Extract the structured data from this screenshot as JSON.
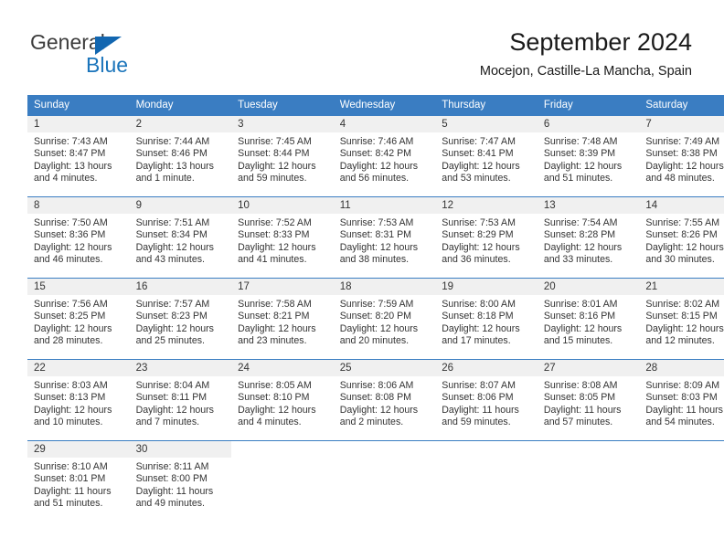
{
  "brand": {
    "name_top": "General",
    "name_bottom": "Blue",
    "accent_color": "#1b75bb",
    "triangle_color": "#1266b0"
  },
  "header": {
    "title": "September 2024",
    "subtitle": "Mocejon, Castille-La Mancha, Spain",
    "header_bg_color": "#3a7dc2",
    "header_text_color": "#ffffff"
  },
  "weekday_headers": [
    "Sunday",
    "Monday",
    "Tuesday",
    "Wednesday",
    "Thursday",
    "Friday",
    "Saturday"
  ],
  "labels": {
    "sunrise_prefix": "Sunrise:",
    "sunset_prefix": "Sunset:",
    "daylight_prefix": "Daylight:"
  },
  "weeks": [
    [
      {
        "day": "1",
        "sunrise": "Sunrise: 7:43 AM",
        "sunset": "Sunset: 8:47 PM",
        "daylight1": "Daylight: 13 hours",
        "daylight2": "and 4 minutes."
      },
      {
        "day": "2",
        "sunrise": "Sunrise: 7:44 AM",
        "sunset": "Sunset: 8:46 PM",
        "daylight1": "Daylight: 13 hours",
        "daylight2": "and 1 minute."
      },
      {
        "day": "3",
        "sunrise": "Sunrise: 7:45 AM",
        "sunset": "Sunset: 8:44 PM",
        "daylight1": "Daylight: 12 hours",
        "daylight2": "and 59 minutes."
      },
      {
        "day": "4",
        "sunrise": "Sunrise: 7:46 AM",
        "sunset": "Sunset: 8:42 PM",
        "daylight1": "Daylight: 12 hours",
        "daylight2": "and 56 minutes."
      },
      {
        "day": "5",
        "sunrise": "Sunrise: 7:47 AM",
        "sunset": "Sunset: 8:41 PM",
        "daylight1": "Daylight: 12 hours",
        "daylight2": "and 53 minutes."
      },
      {
        "day": "6",
        "sunrise": "Sunrise: 7:48 AM",
        "sunset": "Sunset: 8:39 PM",
        "daylight1": "Daylight: 12 hours",
        "daylight2": "and 51 minutes."
      },
      {
        "day": "7",
        "sunrise": "Sunrise: 7:49 AM",
        "sunset": "Sunset: 8:38 PM",
        "daylight1": "Daylight: 12 hours",
        "daylight2": "and 48 minutes."
      }
    ],
    [
      {
        "day": "8",
        "sunrise": "Sunrise: 7:50 AM",
        "sunset": "Sunset: 8:36 PM",
        "daylight1": "Daylight: 12 hours",
        "daylight2": "and 46 minutes."
      },
      {
        "day": "9",
        "sunrise": "Sunrise: 7:51 AM",
        "sunset": "Sunset: 8:34 PM",
        "daylight1": "Daylight: 12 hours",
        "daylight2": "and 43 minutes."
      },
      {
        "day": "10",
        "sunrise": "Sunrise: 7:52 AM",
        "sunset": "Sunset: 8:33 PM",
        "daylight1": "Daylight: 12 hours",
        "daylight2": "and 41 minutes."
      },
      {
        "day": "11",
        "sunrise": "Sunrise: 7:53 AM",
        "sunset": "Sunset: 8:31 PM",
        "daylight1": "Daylight: 12 hours",
        "daylight2": "and 38 minutes."
      },
      {
        "day": "12",
        "sunrise": "Sunrise: 7:53 AM",
        "sunset": "Sunset: 8:29 PM",
        "daylight1": "Daylight: 12 hours",
        "daylight2": "and 36 minutes."
      },
      {
        "day": "13",
        "sunrise": "Sunrise: 7:54 AM",
        "sunset": "Sunset: 8:28 PM",
        "daylight1": "Daylight: 12 hours",
        "daylight2": "and 33 minutes."
      },
      {
        "day": "14",
        "sunrise": "Sunrise: 7:55 AM",
        "sunset": "Sunset: 8:26 PM",
        "daylight1": "Daylight: 12 hours",
        "daylight2": "and 30 minutes."
      }
    ],
    [
      {
        "day": "15",
        "sunrise": "Sunrise: 7:56 AM",
        "sunset": "Sunset: 8:25 PM",
        "daylight1": "Daylight: 12 hours",
        "daylight2": "and 28 minutes."
      },
      {
        "day": "16",
        "sunrise": "Sunrise: 7:57 AM",
        "sunset": "Sunset: 8:23 PM",
        "daylight1": "Daylight: 12 hours",
        "daylight2": "and 25 minutes."
      },
      {
        "day": "17",
        "sunrise": "Sunrise: 7:58 AM",
        "sunset": "Sunset: 8:21 PM",
        "daylight1": "Daylight: 12 hours",
        "daylight2": "and 23 minutes."
      },
      {
        "day": "18",
        "sunrise": "Sunrise: 7:59 AM",
        "sunset": "Sunset: 8:20 PM",
        "daylight1": "Daylight: 12 hours",
        "daylight2": "and 20 minutes."
      },
      {
        "day": "19",
        "sunrise": "Sunrise: 8:00 AM",
        "sunset": "Sunset: 8:18 PM",
        "daylight1": "Daylight: 12 hours",
        "daylight2": "and 17 minutes."
      },
      {
        "day": "20",
        "sunrise": "Sunrise: 8:01 AM",
        "sunset": "Sunset: 8:16 PM",
        "daylight1": "Daylight: 12 hours",
        "daylight2": "and 15 minutes."
      },
      {
        "day": "21",
        "sunrise": "Sunrise: 8:02 AM",
        "sunset": "Sunset: 8:15 PM",
        "daylight1": "Daylight: 12 hours",
        "daylight2": "and 12 minutes."
      }
    ],
    [
      {
        "day": "22",
        "sunrise": "Sunrise: 8:03 AM",
        "sunset": "Sunset: 8:13 PM",
        "daylight1": "Daylight: 12 hours",
        "daylight2": "and 10 minutes."
      },
      {
        "day": "23",
        "sunrise": "Sunrise: 8:04 AM",
        "sunset": "Sunset: 8:11 PM",
        "daylight1": "Daylight: 12 hours",
        "daylight2": "and 7 minutes."
      },
      {
        "day": "24",
        "sunrise": "Sunrise: 8:05 AM",
        "sunset": "Sunset: 8:10 PM",
        "daylight1": "Daylight: 12 hours",
        "daylight2": "and 4 minutes."
      },
      {
        "day": "25",
        "sunrise": "Sunrise: 8:06 AM",
        "sunset": "Sunset: 8:08 PM",
        "daylight1": "Daylight: 12 hours",
        "daylight2": "and 2 minutes."
      },
      {
        "day": "26",
        "sunrise": "Sunrise: 8:07 AM",
        "sunset": "Sunset: 8:06 PM",
        "daylight1": "Daylight: 11 hours",
        "daylight2": "and 59 minutes."
      },
      {
        "day": "27",
        "sunrise": "Sunrise: 8:08 AM",
        "sunset": "Sunset: 8:05 PM",
        "daylight1": "Daylight: 11 hours",
        "daylight2": "and 57 minutes."
      },
      {
        "day": "28",
        "sunrise": "Sunrise: 8:09 AM",
        "sunset": "Sunset: 8:03 PM",
        "daylight1": "Daylight: 11 hours",
        "daylight2": "and 54 minutes."
      }
    ],
    [
      {
        "day": "29",
        "sunrise": "Sunrise: 8:10 AM",
        "sunset": "Sunset: 8:01 PM",
        "daylight1": "Daylight: 11 hours",
        "daylight2": "and 51 minutes."
      },
      {
        "day": "30",
        "sunrise": "Sunrise: 8:11 AM",
        "sunset": "Sunset: 8:00 PM",
        "daylight1": "Daylight: 11 hours",
        "daylight2": "and 49 minutes."
      },
      {
        "day": "",
        "sunrise": "",
        "sunset": "",
        "daylight1": "",
        "daylight2": ""
      },
      {
        "day": "",
        "sunrise": "",
        "sunset": "",
        "daylight1": "",
        "daylight2": ""
      },
      {
        "day": "",
        "sunrise": "",
        "sunset": "",
        "daylight1": "",
        "daylight2": ""
      },
      {
        "day": "",
        "sunrise": "",
        "sunset": "",
        "daylight1": "",
        "daylight2": ""
      },
      {
        "day": "",
        "sunrise": "",
        "sunset": "",
        "daylight1": "",
        "daylight2": ""
      }
    ]
  ]
}
